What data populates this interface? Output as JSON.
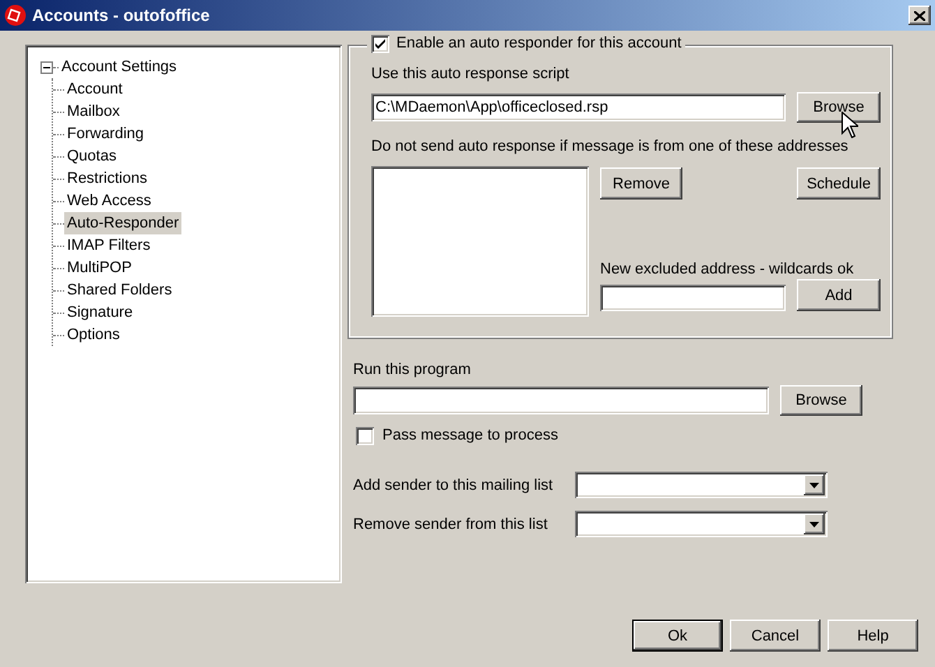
{
  "window": {
    "title": "Accounts - outofoffice"
  },
  "tree": {
    "label": "Account Settings",
    "expanded": true,
    "children": [
      {
        "label": "Account",
        "selected": false
      },
      {
        "label": "Mailbox",
        "selected": false
      },
      {
        "label": "Forwarding",
        "selected": false
      },
      {
        "label": "Quotas",
        "selected": false
      },
      {
        "label": "Restrictions",
        "selected": false
      },
      {
        "label": "Web Access",
        "selected": false
      },
      {
        "label": "Auto-Responder",
        "selected": true
      },
      {
        "label": "IMAP Filters",
        "selected": false
      },
      {
        "label": "MultiPOP",
        "selected": false
      },
      {
        "label": "Shared Folders",
        "selected": false
      },
      {
        "label": "Signature",
        "selected": false
      },
      {
        "label": "Options",
        "selected": false
      }
    ]
  },
  "auto_responder": {
    "enable": {
      "label": "Enable an auto responder for this account",
      "checked": true
    },
    "script_label": "Use this auto response script",
    "script_value": "C:\\MDaemon\\App\\officeclosed.rsp",
    "browse_button": "Browse",
    "exclude_label": "Do not send auto response if message is from one of these addresses",
    "remove_button": "Remove",
    "schedule_button": "Schedule",
    "new_address_label": "New excluded address - wildcards ok",
    "add_button": "Add"
  },
  "run_program": {
    "label": "Run this program",
    "browse_button": "Browse",
    "pass_message": {
      "label": "Pass message to process",
      "checked": false
    }
  },
  "mailing_lists": [
    {
      "label": "Add sender to this mailing list"
    },
    {
      "label": "Remove sender from this list"
    }
  ],
  "buttons": [
    {
      "label": "Ok",
      "default": true
    },
    {
      "label": "Cancel",
      "default": false
    },
    {
      "label": "Help",
      "default": false
    }
  ]
}
